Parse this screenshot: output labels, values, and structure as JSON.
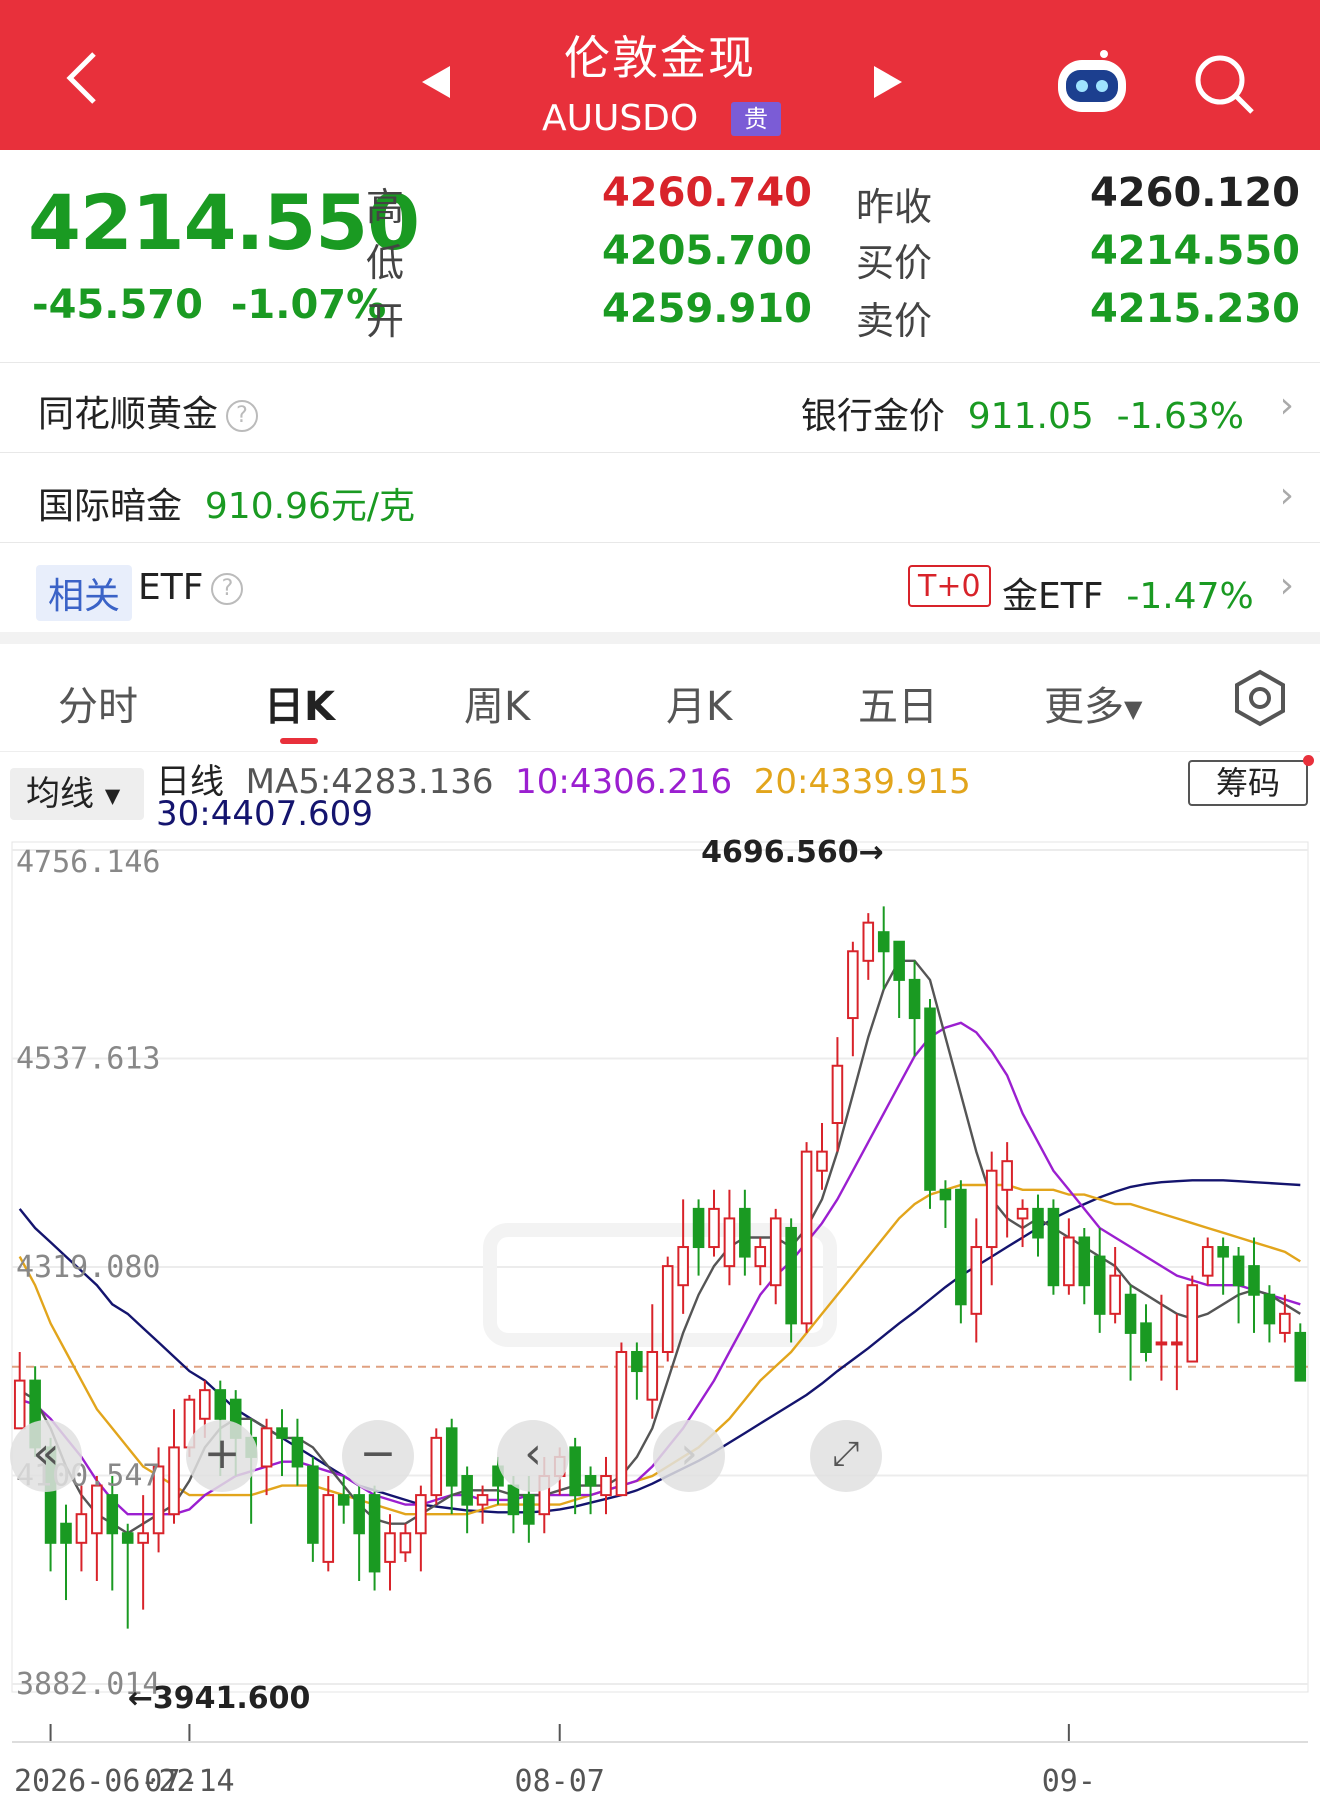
{
  "header": {
    "title": "伦敦金现",
    "code": "AUUSDO",
    "tag": "贵"
  },
  "quote": {
    "price": "4214.550",
    "change": "-45.570",
    "change_pct": "-1.07%",
    "high_label": "高",
    "low_label": "低",
    "open_label": "开",
    "high": "4260.740",
    "low": "4205.700",
    "open": "4259.910",
    "prev_label": "昨收",
    "bid_label": "买价",
    "ask_label": "卖价",
    "prev": "4260.120",
    "bid": "4214.550",
    "ask": "4215.230"
  },
  "rows": {
    "ths_gold": "同花顺黄金",
    "bank_label": "银行金价",
    "bank_value": "911.05",
    "bank_pct": "-1.63%",
    "intl_label": "国际暗金",
    "intl_value": "910.96元/克",
    "related_tag": "相关",
    "etf_label": "ETF",
    "t0": "T+0",
    "gold_etf": "金ETF",
    "gold_etf_pct": "-1.47%"
  },
  "tabs": [
    "分时",
    "日K",
    "周K",
    "月K",
    "五日",
    "更多"
  ],
  "ma": {
    "junxian": "均线",
    "daily": "日线",
    "ma5": "MA5:4283.136",
    "ma10": "10:4306.216",
    "ma20": "20:4339.915",
    "ma30": "30:4407.609",
    "chouma": "筹码"
  },
  "colors": {
    "up": "#d8232a",
    "down": "#1a9a22",
    "ma5": "#555555",
    "ma10": "#9b1fd0",
    "ma20": "#e2a51c",
    "ma30": "#14146e",
    "brand": "#e8303b"
  },
  "chart_data": {
    "type": "candlestick",
    "y_ticks": [
      "4756.146",
      "4537.613",
      "4319.080",
      "4100.547",
      "3882.014"
    ],
    "ylim": [
      3882.014,
      4756.146
    ],
    "x_ticks": [
      "2026-06-22",
      "07-14",
      "08-07",
      "09-"
    ],
    "max_label": "4696.560→",
    "min_label": "←3941.600",
    "last_close": 4214.55,
    "candles": [
      [
        4150,
        4200,
        4180,
        4230
      ],
      [
        4200,
        4130,
        4120,
        4215
      ],
      [
        4130,
        4030,
        4000,
        4140
      ],
      [
        4050,
        4030,
        3970,
        4070
      ],
      [
        4030,
        4060,
        4000,
        4090
      ],
      [
        4040,
        4090,
        3990,
        4100
      ],
      [
        4080,
        4040,
        3980,
        4100
      ],
      [
        4040,
        4030,
        3940,
        4050
      ],
      [
        4030,
        4040,
        3960,
        4080
      ],
      [
        4040,
        4110,
        4020,
        4130
      ],
      [
        4060,
        4130,
        4050,
        4170
      ],
      [
        4130,
        4180,
        4120,
        4185
      ],
      [
        4160,
        4190,
        4140,
        4200
      ],
      [
        4190,
        4160,
        4100,
        4200
      ],
      [
        4180,
        4140,
        4100,
        4190
      ],
      [
        4140,
        4120,
        4050,
        4160
      ],
      [
        4110,
        4150,
        4080,
        4160
      ],
      [
        4150,
        4140,
        4100,
        4170
      ],
      [
        4140,
        4110,
        4090,
        4160
      ],
      [
        4110,
        4030,
        4010,
        4120
      ],
      [
        4010,
        4080,
        4000,
        4100
      ],
      [
        4080,
        4070,
        4050,
        4100
      ],
      [
        4080,
        4040,
        3990,
        4090
      ],
      [
        4080,
        4000,
        3980,
        4090
      ],
      [
        4010,
        4040,
        3980,
        4060
      ],
      [
        4020,
        4040,
        4010,
        4050
      ],
      [
        4040,
        4080,
        4000,
        4090
      ],
      [
        4080,
        4140,
        4070,
        4150
      ],
      [
        4150,
        4090,
        4060,
        4160
      ],
      [
        4100,
        4070,
        4040,
        4110
      ],
      [
        4070,
        4080,
        4050,
        4090
      ],
      [
        4110,
        4090,
        4070,
        4120
      ],
      [
        4090,
        4060,
        4040,
        4100
      ],
      [
        4080,
        4050,
        4030,
        4100
      ],
      [
        4060,
        4100,
        4040,
        4120
      ],
      [
        4100,
        4120,
        4080,
        4130
      ],
      [
        4130,
        4080,
        4060,
        4140
      ],
      [
        4100,
        4090,
        4060,
        4110
      ],
      [
        4080,
        4100,
        4060,
        4120
      ],
      [
        4080,
        4230,
        4080,
        4240
      ],
      [
        4230,
        4210,
        4180,
        4240
      ],
      [
        4180,
        4230,
        4160,
        4280
      ],
      [
        4230,
        4320,
        4220,
        4330
      ],
      [
        4300,
        4340,
        4270,
        4390
      ],
      [
        4380,
        4340,
        4310,
        4390
      ],
      [
        4340,
        4380,
        4330,
        4400
      ],
      [
        4320,
        4370,
        4300,
        4400
      ],
      [
        4380,
        4330,
        4310,
        4400
      ],
      [
        4320,
        4340,
        4300,
        4350
      ],
      [
        4300,
        4370,
        4280,
        4380
      ],
      [
        4360,
        4260,
        4240,
        4370
      ],
      [
        4260,
        4440,
        4250,
        4450
      ],
      [
        4420,
        4440,
        4400,
        4470
      ],
      [
        4470,
        4530,
        4440,
        4560
      ],
      [
        4580,
        4650,
        4540,
        4660
      ],
      [
        4640,
        4680,
        4620,
        4690
      ],
      [
        4670,
        4650,
        4610,
        4697
      ],
      [
        4660,
        4620,
        4580,
        4650
      ],
      [
        4620,
        4580,
        4540,
        4640
      ],
      [
        4590,
        4400,
        4380,
        4600
      ],
      [
        4400,
        4390,
        4360,
        4410
      ],
      [
        4400,
        4280,
        4260,
        4410
      ],
      [
        4270,
        4340,
        4240,
        4370
      ],
      [
        4340,
        4420,
        4300,
        4440
      ],
      [
        4400,
        4430,
        4350,
        4450
      ],
      [
        4370,
        4380,
        4340,
        4390
      ],
      [
        4380,
        4350,
        4330,
        4395
      ],
      [
        4380,
        4300,
        4290,
        4390
      ],
      [
        4300,
        4350,
        4290,
        4370
      ],
      [
        4350,
        4300,
        4280,
        4360
      ],
      [
        4330,
        4270,
        4250,
        4360
      ],
      [
        4270,
        4310,
        4260,
        4340
      ],
      [
        4290,
        4250,
        4200,
        4300
      ],
      [
        4260,
        4230,
        4220,
        4280
      ],
      [
        4240,
        4240,
        4200,
        4290
      ],
      [
        4240,
        4240,
        4190,
        4270
      ],
      [
        4220,
        4300,
        4220,
        4310
      ],
      [
        4310,
        4340,
        4300,
        4350
      ],
      [
        4340,
        4330,
        4290,
        4350
      ],
      [
        4330,
        4300,
        4260,
        4340
      ],
      [
        4320,
        4290,
        4250,
        4350
      ],
      [
        4290,
        4260,
        4240,
        4300
      ],
      [
        4250,
        4270,
        4240,
        4290
      ],
      [
        4250,
        4200,
        4200,
        4260
      ]
    ],
    "ma5": [
      4190,
      4180,
      4150,
      4110,
      4080,
      4060,
      4050,
      4040,
      4050,
      4060,
      4070,
      4095,
      4130,
      4150,
      4160,
      4160,
      4150,
      4140,
      4140,
      4130,
      4110,
      4090,
      4070,
      4055,
      4050,
      4050,
      4060,
      4070,
      4080,
      4085,
      4085,
      4085,
      4080,
      4080,
      4080,
      4085,
      4090,
      4090,
      4090,
      4100,
      4120,
      4150,
      4200,
      4250,
      4290,
      4320,
      4340,
      4350,
      4350,
      4350,
      4340,
      4360,
      4390,
      4440,
      4500,
      4560,
      4610,
      4640,
      4640,
      4620,
      4560,
      4500,
      4440,
      4390,
      4370,
      4360,
      4370,
      4360,
      4350,
      4340,
      4330,
      4320,
      4300,
      4290,
      4280,
      4270,
      4265,
      4270,
      4280,
      4290,
      4295,
      4290,
      4280,
      4270
    ],
    "ma10": [
      4180,
      4175,
      4160,
      4140,
      4120,
      4095,
      4075,
      4060,
      4060,
      4060,
      4060,
      4065,
      4080,
      4090,
      4100,
      4105,
      4110,
      4115,
      4115,
      4110,
      4105,
      4100,
      4090,
      4080,
      4075,
      4070,
      4070,
      4075,
      4080,
      4080,
      4075,
      4075,
      4075,
      4080,
      4080,
      4080,
      4080,
      4080,
      4085,
      4090,
      4095,
      4110,
      4130,
      4150,
      4175,
      4200,
      4230,
      4260,
      4290,
      4310,
      4325,
      4345,
      4365,
      4390,
      4420,
      4450,
      4480,
      4510,
      4540,
      4560,
      4570,
      4575,
      4565,
      4545,
      4520,
      4480,
      4450,
      4420,
      4400,
      4380,
      4360,
      4350,
      4340,
      4330,
      4320,
      4310,
      4305,
      4300,
      4300,
      4300,
      4295,
      4290,
      4285,
      4280
    ],
    "ma20": [
      4330,
      4300,
      4260,
      4230,
      4200,
      4170,
      4150,
      4130,
      4110,
      4100,
      4090,
      4080,
      4080,
      4080,
      4080,
      4080,
      4085,
      4090,
      4090,
      4090,
      4085,
      4080,
      4075,
      4070,
      4065,
      4060,
      4060,
      4060,
      4060,
      4060,
      4065,
      4070,
      4070,
      4070,
      4070,
      4070,
      4075,
      4080,
      4085,
      4090,
      4095,
      4100,
      4110,
      4120,
      4130,
      4145,
      4160,
      4180,
      4200,
      4215,
      4230,
      4250,
      4270,
      4290,
      4310,
      4330,
      4350,
      4370,
      4385,
      4395,
      4400,
      4405,
      4405,
      4405,
      4405,
      4400,
      4400,
      4400,
      4395,
      4395,
      4390,
      4385,
      4385,
      4380,
      4375,
      4370,
      4365,
      4360,
      4355,
      4350,
      4345,
      4340,
      4335,
      4325
    ],
    "ma30": [
      4380,
      4360,
      4345,
      4330,
      4315,
      4300,
      4280,
      4270,
      4255,
      4240,
      4225,
      4210,
      4200,
      4185,
      4170,
      4160,
      4150,
      4140,
      4130,
      4120,
      4110,
      4100,
      4090,
      4085,
      4080,
      4075,
      4070,
      4068,
      4066,
      4064,
      4063,
      4062,
      4062,
      4062,
      4063,
      4065,
      4068,
      4072,
      4076,
      4080,
      4085,
      4092,
      4100,
      4108,
      4116,
      4125,
      4135,
      4145,
      4155,
      4165,
      4175,
      4185,
      4197,
      4210,
      4222,
      4234,
      4247,
      4260,
      4272,
      4285,
      4298,
      4310,
      4320,
      4330,
      4340,
      4350,
      4360,
      4370,
      4378,
      4385,
      4392,
      4398,
      4403,
      4406,
      4408,
      4409,
      4410,
      4410,
      4410,
      4409,
      4408,
      4407,
      4406,
      4405
    ]
  }
}
